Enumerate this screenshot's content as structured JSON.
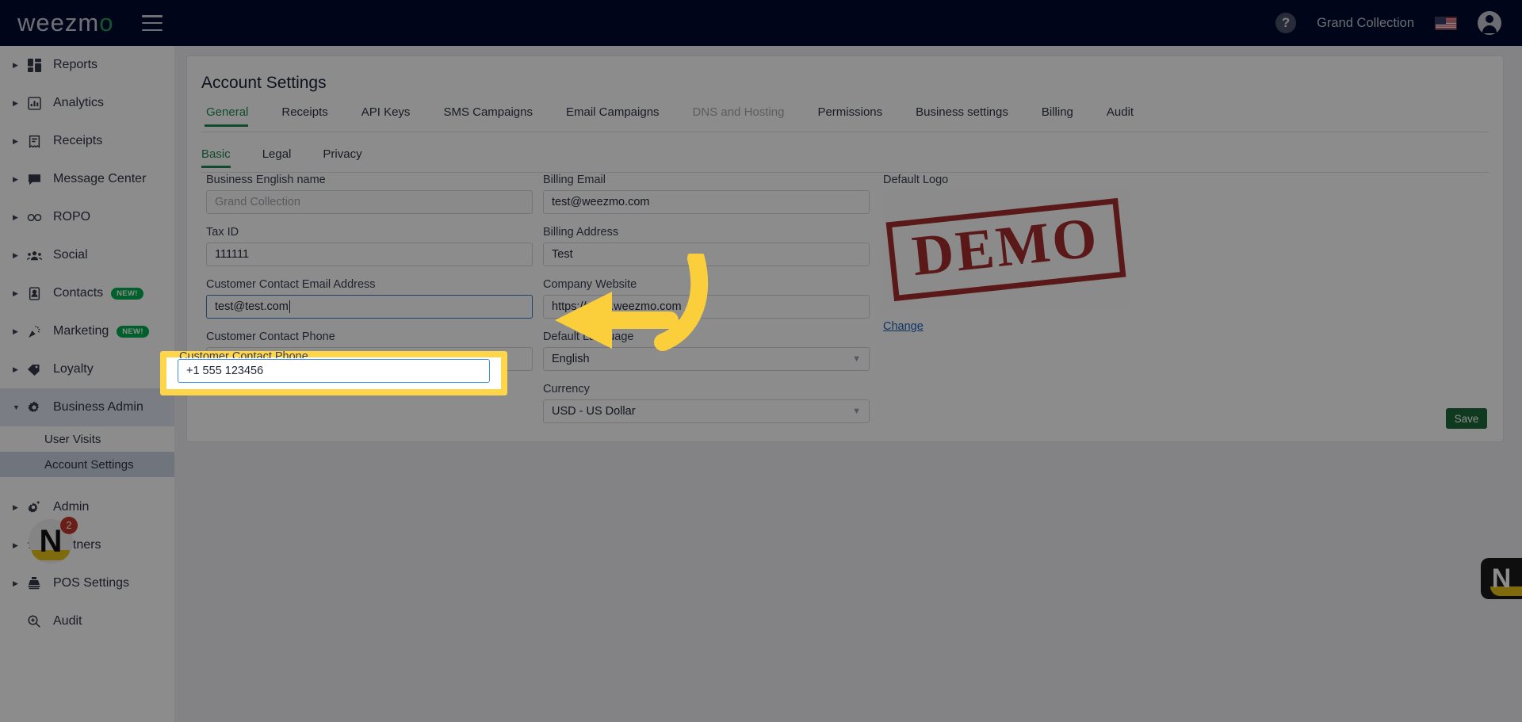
{
  "topbar": {
    "brand": "weezm",
    "brand_suffix": "o",
    "menu_icon": "hamburger-icon",
    "help_icon": "?",
    "account_name": "Grand Collection",
    "flag_icon": "us-flag-icon",
    "avatar_icon": "user-avatar-icon"
  },
  "sidebar": {
    "items": [
      {
        "label": "Reports",
        "icon": "dashboard-icon",
        "badge": "",
        "expandable": true,
        "expanded": false
      },
      {
        "label": "Analytics",
        "icon": "chart-icon",
        "badge": "",
        "expandable": true,
        "expanded": false
      },
      {
        "label": "Receipts",
        "icon": "receipt-icon",
        "badge": "",
        "expandable": true,
        "expanded": false
      },
      {
        "label": "Message Center",
        "icon": "chat-icon",
        "badge": "",
        "expandable": true,
        "expanded": false
      },
      {
        "label": "ROPO",
        "icon": "infinity-icon",
        "badge": "",
        "expandable": true,
        "expanded": false
      },
      {
        "label": "Social",
        "icon": "people-icon",
        "badge": "",
        "expandable": true,
        "expanded": false
      },
      {
        "label": "Contacts",
        "icon": "contact-icon",
        "badge": "NEW!",
        "expandable": true,
        "expanded": false
      },
      {
        "label": "Marketing",
        "icon": "megaphone-icon",
        "badge": "NEW!",
        "expandable": true,
        "expanded": false
      },
      {
        "label": "Loyalty",
        "icon": "tag-icon",
        "badge": "",
        "expandable": true,
        "expanded": false
      },
      {
        "label": "Business Admin",
        "icon": "gear-icon",
        "badge": "",
        "expandable": true,
        "expanded": true
      }
    ],
    "sub_items": [
      {
        "label": "User Visits",
        "selected": false
      },
      {
        "label": "Account Settings",
        "selected": true
      }
    ],
    "items_after": [
      {
        "label": "Admin",
        "icon": "gear-plus-icon",
        "badge": "",
        "expandable": true
      },
      {
        "label": "Partners",
        "icon": "layers-icon",
        "badge": "",
        "expandable": true
      },
      {
        "label": "POS Settings",
        "icon": "pos-icon",
        "badge": "",
        "expandable": true
      },
      {
        "label": "Audit",
        "icon": "magnifier-icon",
        "badge": "",
        "expandable": false
      }
    ],
    "avatar": {
      "letter": "N",
      "badge_count": "2"
    }
  },
  "main": {
    "page_title": "Account Settings",
    "tabs": [
      {
        "label": "General",
        "active": true,
        "disabled": false
      },
      {
        "label": "Receipts",
        "active": false,
        "disabled": false
      },
      {
        "label": "API Keys",
        "active": false,
        "disabled": false
      },
      {
        "label": "SMS Campaigns",
        "active": false,
        "disabled": false
      },
      {
        "label": "Email Campaigns",
        "active": false,
        "disabled": false
      },
      {
        "label": "DNS and Hosting",
        "active": false,
        "disabled": true
      },
      {
        "label": "Permissions",
        "active": false,
        "disabled": false
      },
      {
        "label": "Business settings",
        "active": false,
        "disabled": false
      },
      {
        "label": "Billing",
        "active": false,
        "disabled": false
      },
      {
        "label": "Audit",
        "active": false,
        "disabled": false
      }
    ],
    "subtabs": [
      {
        "label": "Basic",
        "active": true
      },
      {
        "label": "Legal",
        "active": false
      },
      {
        "label": "Privacy",
        "active": false
      }
    ],
    "fields": {
      "business_name": {
        "label": "Business English name",
        "value": "",
        "placeholder": "Grand Collection"
      },
      "tax_id": {
        "label": "Tax ID",
        "value": "111111",
        "placeholder": ""
      },
      "contact_email": {
        "label": "Customer Contact Email Address",
        "value": "test@test.com",
        "placeholder": ""
      },
      "contact_phone": {
        "label": "Customer Contact Phone",
        "value": "+1 555 123456",
        "placeholder": ""
      },
      "billing_email": {
        "label": "Billing Email",
        "value": "test@weezmo.com",
        "placeholder": ""
      },
      "billing_address": {
        "label": "Billing Address",
        "value": "Test",
        "placeholder": ""
      },
      "company_website": {
        "label": "Company Website",
        "value": "https://www.weezmo.com",
        "placeholder": ""
      },
      "default_language": {
        "label": "Default Language",
        "value": "English",
        "placeholder": ""
      },
      "currency": {
        "label": "Currency",
        "value": "USD - US Dollar",
        "placeholder": ""
      }
    },
    "logo": {
      "label": "Default Logo",
      "stamp_text": "DEMO",
      "change_label": "Change"
    },
    "save_label": "Save"
  },
  "widget": {
    "letter": "N"
  },
  "colors": {
    "topbar_bg": "#020a2e",
    "accent_green": "#1e8a4f",
    "save_green": "#1d6b3a",
    "highlight_yellow": "#FFD54A",
    "focus_blue": "#3b92e0",
    "link_blue": "#1a5fb4",
    "badge_green": "#00b050",
    "stamp_red": "#9e1b1b"
  }
}
